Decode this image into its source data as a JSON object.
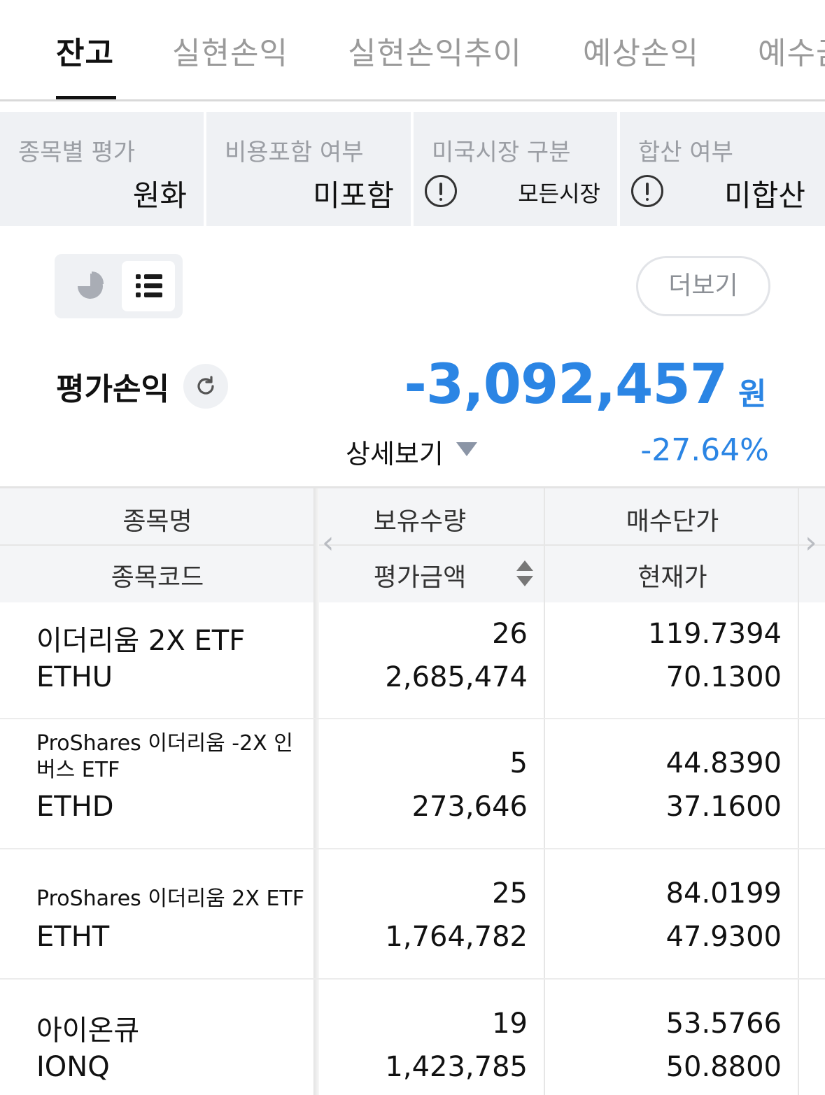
{
  "tabs": [
    {
      "label": "잔고",
      "active": true
    },
    {
      "label": "실현손익",
      "active": false
    },
    {
      "label": "실현손익추이",
      "active": false
    },
    {
      "label": "예상손익",
      "active": false
    },
    {
      "label": "예수금",
      "active": false
    }
  ],
  "settings": [
    {
      "title": "종목별 평가",
      "value": "원화"
    },
    {
      "title": "비용포함 여부",
      "value": "미포함"
    },
    {
      "title": "미국시장 구분",
      "value": "모든시장"
    },
    {
      "title": "합산 여부",
      "value": "미합산"
    }
  ],
  "toolbar": {
    "more_label": "더보기",
    "view_mode": "list"
  },
  "summary": {
    "label": "평가손익",
    "amount": "-3,092,457",
    "unit": "원",
    "detail_label": "상세보기",
    "rate": "-27.64%",
    "accent_color": "#2b85e4"
  },
  "table": {
    "headers": {
      "name": "종목명",
      "code": "종목코드",
      "quantity": "보유수량",
      "eval_amount": "평가금액",
      "buy_price": "매수단가",
      "current_price": "현재가"
    },
    "rows": [
      {
        "name": "이더리움 2X ETF",
        "code": "ETHU",
        "quantity": "26",
        "eval_amount": "2,685,474",
        "buy_price": "119.7394",
        "current_price": "70.1300"
      },
      {
        "name": "ProShares 이더리움 -2X 인버스 ETF",
        "code": "ETHD",
        "quantity": "5",
        "eval_amount": "273,646",
        "buy_price": "44.8390",
        "current_price": "37.1600"
      },
      {
        "name": "ProShares 이더리움 2X ETF",
        "code": "ETHT",
        "quantity": "25",
        "eval_amount": "1,764,782",
        "buy_price": "84.0199",
        "current_price": "47.9300"
      },
      {
        "name": "아이온큐",
        "code": "IONQ",
        "quantity": "19",
        "eval_amount": "1,423,785",
        "buy_price": "53.5766",
        "current_price": "50.8800"
      }
    ]
  }
}
